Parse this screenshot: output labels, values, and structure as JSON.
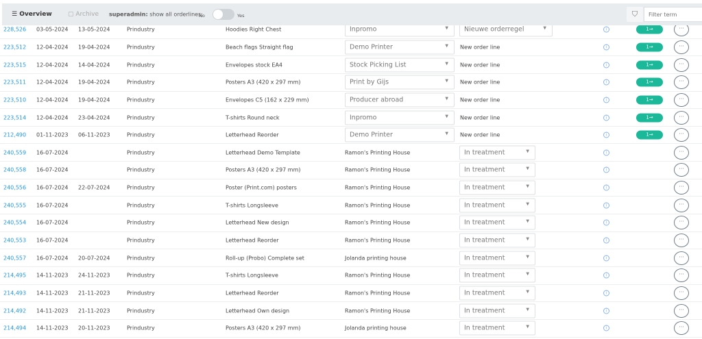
{
  "header": {
    "overview": "Overview",
    "archive": "Archive",
    "superadmin_label": "superadmin:",
    "show_all": "show all orderlines:",
    "no": "No",
    "yes": "Yes",
    "filter_placeholder": "Filter term"
  },
  "rows": [
    {
      "id": "228,526",
      "date1": "03-05-2024",
      "date2": "13-05-2024",
      "company": "Prindustry",
      "product": "Hoodies Right Chest",
      "supplier_select": "Inpromo",
      "status_select": "Nieuwe orderregel",
      "go": true
    },
    {
      "id": "223,512",
      "date1": "12-04-2024",
      "date2": "19-04-2024",
      "company": "Prindustry",
      "product": "Beach flags Straight flag",
      "supplier_select": "Demo Printer",
      "status": "New order line",
      "go": true
    },
    {
      "id": "223,515",
      "date1": "12-04-2024",
      "date2": "14-04-2024",
      "company": "Prindustry",
      "product": "Envelopes stock EA4",
      "supplier_select": "Stock Picking List",
      "status": "New order line",
      "go": true
    },
    {
      "id": "223,511",
      "date1": "12-04-2024",
      "date2": "19-04-2024",
      "company": "Prindustry",
      "product": "Posters A3 (420 x 297 mm)",
      "supplier_select": "Print by Gijs",
      "status": "New order line",
      "go": true
    },
    {
      "id": "223,510",
      "date1": "12-04-2024",
      "date2": "19-04-2024",
      "company": "Prindustry",
      "product": "Envelopes C5 (162 x 229 mm)",
      "supplier_select": "Producer abroad",
      "status": "New order line",
      "go": true
    },
    {
      "id": "223,514",
      "date1": "12-04-2024",
      "date2": "23-04-2024",
      "company": "Prindustry",
      "product": "T-shirts Round neck",
      "supplier_select": "Inpromo",
      "status": "New order line",
      "go": true
    },
    {
      "id": "212,490",
      "date1": "01-11-2023",
      "date2": "06-11-2023",
      "company": "Prindustry",
      "product": "Letterhead Reorder",
      "supplier_select": "Demo Printer",
      "status": "New order line",
      "go": true
    },
    {
      "id": "240,559",
      "date1": "16-07-2024",
      "date2": "",
      "company": "Prindustry",
      "product": "Letterhead Demo Template",
      "supplier": "Ramon's Printing House",
      "status_select": "In treatment"
    },
    {
      "id": "240,558",
      "date1": "16-07-2024",
      "date2": "",
      "company": "Prindustry",
      "product": "Posters A3 (420 x 297 mm)",
      "supplier": "Ramon's Printing House",
      "status_select": "In treatment"
    },
    {
      "id": "240,556",
      "date1": "16-07-2024",
      "date2": "22-07-2024",
      "company": "Prindustry",
      "product": "Poster (Print.com) posters",
      "supplier": "Ramon's Printing House",
      "status_select": "In treatment"
    },
    {
      "id": "240,555",
      "date1": "16-07-2024",
      "date2": "",
      "company": "Prindustry",
      "product": "T-shirts Longsleeve",
      "supplier": "Ramon's Printing House",
      "status_select": "In treatment"
    },
    {
      "id": "240,554",
      "date1": "16-07-2024",
      "date2": "",
      "company": "Prindustry",
      "product": "Letterhead New design",
      "supplier": "Ramon's Printing House",
      "status_select": "In treatment"
    },
    {
      "id": "240,553",
      "date1": "16-07-2024",
      "date2": "",
      "company": "Prindustry",
      "product": "Letterhead Reorder",
      "supplier": "Ramon's Printing House",
      "status_select": "In treatment"
    },
    {
      "id": "240,557",
      "date1": "16-07-2024",
      "date2": "20-07-2024",
      "company": "Prindustry",
      "product": "Roll-up (Probo) Complete set",
      "supplier": "Jolanda printing house",
      "status_select": "In treatment"
    },
    {
      "id": "214,495",
      "date1": "14-11-2023",
      "date2": "24-11-2023",
      "company": "Prindustry",
      "product": "T-shirts Longsleeve",
      "supplier": "Ramon's Printing House",
      "status_select": "In treatment"
    },
    {
      "id": "214,493",
      "date1": "14-11-2023",
      "date2": "21-11-2023",
      "company": "Prindustry",
      "product": "Letterhead Reorder",
      "supplier": "Ramon's Printing House",
      "status_select": "In treatment"
    },
    {
      "id": "214,492",
      "date1": "14-11-2023",
      "date2": "21-11-2023",
      "company": "Prindustry",
      "product": "Letterhead Own design",
      "supplier": "Ramon's Printing House",
      "status_select": "In treatment"
    },
    {
      "id": "214,494",
      "date1": "14-11-2023",
      "date2": "20-11-2023",
      "company": "Prindustry",
      "product": "Posters A3 (420 x 297 mm)",
      "supplier": "Jolanda printing house",
      "status_select": "In treatment"
    }
  ],
  "icons": {
    "info": "i",
    "go": "1→",
    "more": "···",
    "filter": "⛉"
  }
}
